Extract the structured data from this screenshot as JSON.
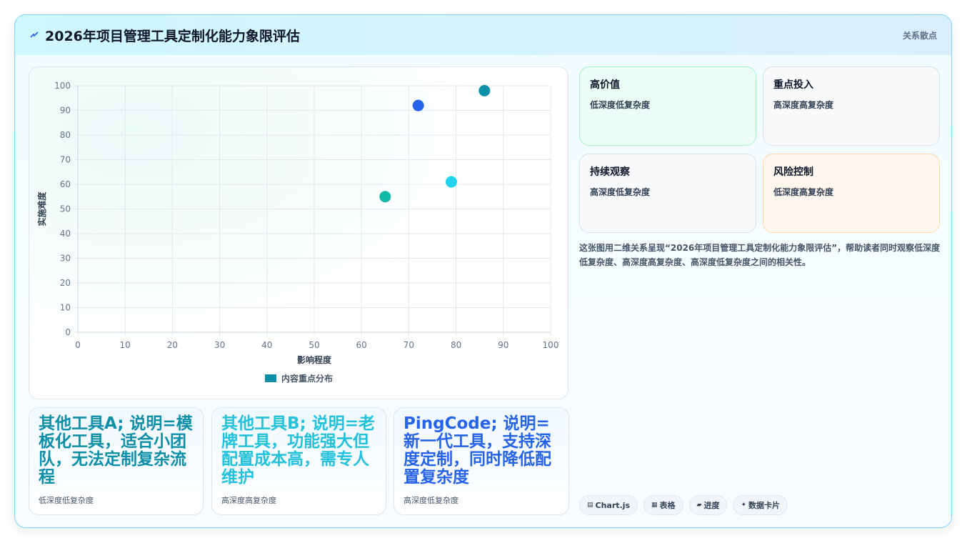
{
  "header": {
    "title": "2026年项目管理工具定制化能力象限评估",
    "tag": "关系散点"
  },
  "chart_data": {
    "type": "scatter",
    "xlabel": "影响程度",
    "ylabel": "实施难度",
    "xlim": [
      0,
      100
    ],
    "ylim": [
      0,
      100
    ],
    "xticks": [
      "0",
      "10",
      "20",
      "30",
      "40",
      "50",
      "60",
      "70",
      "80",
      "90",
      "100"
    ],
    "yticks": [
      "0",
      "10",
      "20",
      "30",
      "40",
      "50",
      "60",
      "70",
      "80",
      "90",
      "100"
    ],
    "grid": true,
    "legend_position": "bottom",
    "series": [
      {
        "name": "内容重点分布",
        "color": "#0e8fa8",
        "points": [
          {
            "x": 65,
            "y": 55,
            "color": "#14b8a6"
          },
          {
            "x": 72,
            "y": 92,
            "color": "#2563eb"
          },
          {
            "x": 79,
            "y": 61,
            "color": "#22d3ee"
          },
          {
            "x": 86,
            "y": 98,
            "color": "#0e8fa8"
          }
        ]
      }
    ]
  },
  "quadrants": [
    {
      "title": "高价值",
      "sub": "低深度低复杂度"
    },
    {
      "title": "重点投入",
      "sub": "高深度高复杂度"
    },
    {
      "title": "持续观察",
      "sub": "高深度低复杂度"
    },
    {
      "title": "风险控制",
      "sub": "低深度高复杂度"
    }
  ],
  "description": "这张图用二维关系呈现“2026年项目管理工具定制化能力象限评估”，帮助读者同时观察低深度低复杂度、高深度高复杂度、高深度低复杂度之间的相关性。",
  "tools": [
    {
      "name": "其他工具A; 说明=模板化工具，适合小团队，无法定制复杂流程",
      "sub": "低深度低复杂度",
      "color": "#0e8fa8"
    },
    {
      "name": "其他工具B; 说明=老牌工具，功能强大但配置成本高，需专人维护",
      "sub": "高深度高复杂度",
      "color": "#22c1dc"
    },
    {
      "name": "PingCode; 说明=新一代工具，支持深度定制，同时降低配置复杂度",
      "sub": "高深度低复杂度",
      "color": "#2563eb"
    }
  ],
  "chips": [
    {
      "icon": "▤",
      "label": "Chart.js"
    },
    {
      "icon": "▦",
      "label": "表格"
    },
    {
      "icon": "▰",
      "label": "进度"
    },
    {
      "icon": "✦",
      "label": "数据卡片"
    }
  ]
}
